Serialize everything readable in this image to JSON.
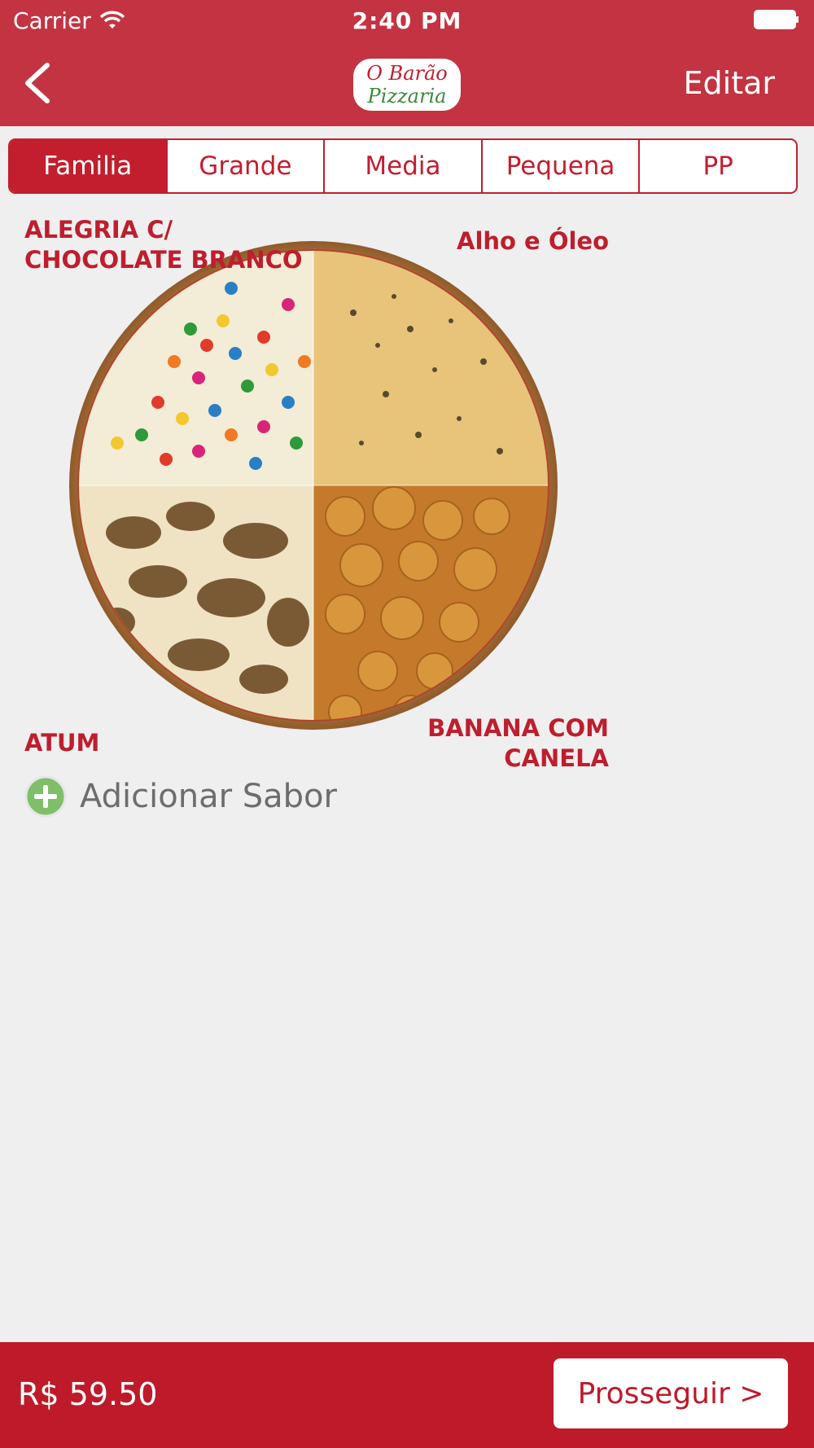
{
  "status_bar": {
    "carrier": "Carrier",
    "time": "2:40 PM"
  },
  "header": {
    "logo_line1": "O Barão",
    "logo_line2": "Pizzaria",
    "edit_label": "Editar"
  },
  "sizes": {
    "tabs": [
      "Familia",
      "Grande",
      "Media",
      "Pequena",
      "PP"
    ],
    "selected": "Familia"
  },
  "pizza": {
    "flavors": {
      "top_left": "ALEGRIA C/ CHOCOLATE BRANCO",
      "top_right": "Alho e Óleo",
      "bottom_left": "ATUM",
      "bottom_right": "BANANA COM CANELA"
    }
  },
  "add_flavor_label": "Adicionar Sabor",
  "footer": {
    "price": "R$ 59.50",
    "proceed_label": "Prosseguir >"
  },
  "colors": {
    "header": "#c33341",
    "accent": "#be1e2d",
    "background": "#efefef"
  }
}
